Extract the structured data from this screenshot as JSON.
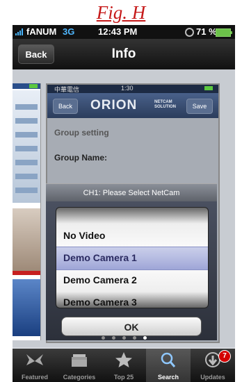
{
  "figure": {
    "title": "Fig. H"
  },
  "status_bar": {
    "carrier": "fANUM",
    "network": "3G",
    "time": "12:43 PM",
    "battery": "71 %"
  },
  "nav_bar": {
    "back_label": "Back",
    "title": "Info"
  },
  "inner_screen": {
    "carrier": "中華電信",
    "time": "1:30",
    "back_label": "Back",
    "logo": "ORION",
    "logo_sub": "NETCAM SOLUTION",
    "save_label": "Save",
    "group_setting": "Group setting",
    "group_name": "Group Name:"
  },
  "picker": {
    "prompt": "CH1: Please Select NetCam",
    "options": [
      "No Video",
      "Demo Camera 1",
      "Demo Camera 2",
      "Demo Camera 3"
    ],
    "selected": "Demo Camera 1",
    "ok_label": "OK"
  },
  "page_dots": {
    "count": 5,
    "active_index": 4
  },
  "tab_bar": {
    "tabs": [
      {
        "label": "Featured",
        "icon": "featured-icon"
      },
      {
        "label": "Categories",
        "icon": "categories-icon"
      },
      {
        "label": "Top 25",
        "icon": "star-icon"
      },
      {
        "label": "Search",
        "icon": "search-icon",
        "active": true
      },
      {
        "label": "Updates",
        "icon": "updates-icon",
        "badge": "7"
      }
    ]
  }
}
